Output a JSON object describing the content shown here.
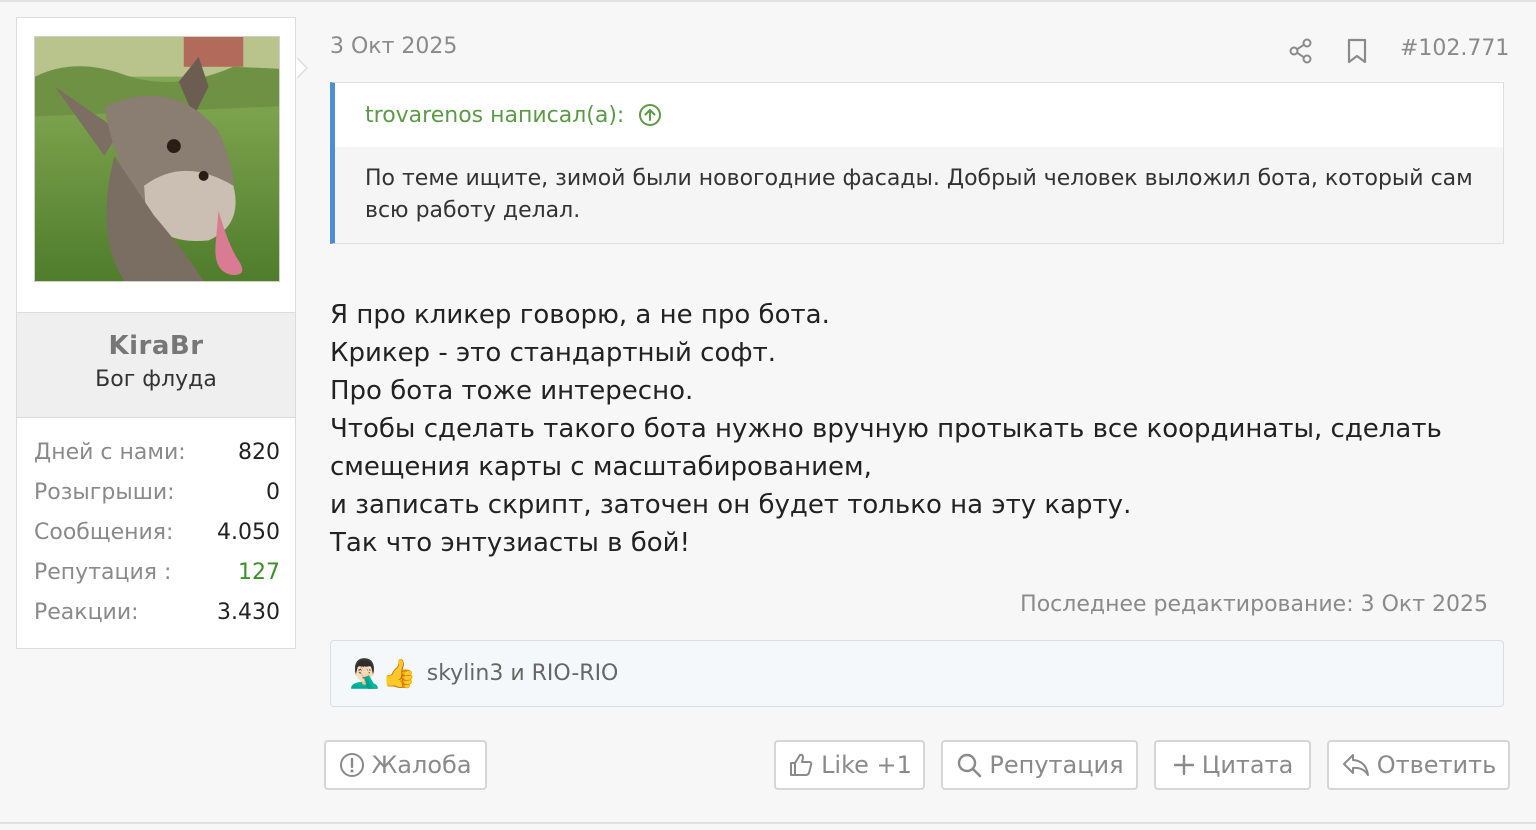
{
  "user": {
    "name": "KiraBr",
    "title": "Бог флуда",
    "stats": [
      {
        "label": "Дней с нами:",
        "value": "820"
      },
      {
        "label": "Розыгрыши:",
        "value": "0"
      },
      {
        "label": "Сообщения:",
        "value": "4.050"
      },
      {
        "label": "Репутация :",
        "value": "127"
      },
      {
        "label": "Реакции:",
        "value": "3.430"
      }
    ]
  },
  "post": {
    "date": "3 Окт 2025",
    "number": "#102.771",
    "quote": {
      "author_line": "trovarenos написал(а):",
      "text": "По теме ищите, зимой были новогодние фасады. Добрый человек выложил бота, который сам всю работу делал."
    },
    "message_lines": [
      "Я про кликер говорю, а не про бота.",
      "Крикер - это стандартный софт.",
      "Про бота тоже интересно.",
      "Чтобы сделать такого бота нужно вручную протыкать все координаты, сделать смещения карты с масштабированием,",
      "и записать скрипт, заточен он будет только на эту карту.",
      "Так что энтузиасты в бой!"
    ],
    "last_edit": "Последнее редактирование: 3 Окт 2025",
    "reactions": {
      "icons": [
        "🤦🏻‍♂️",
        "👍"
      ],
      "users": "skylin3 и RIO-RIO"
    }
  },
  "actions": {
    "report": "Жалоба",
    "like": "Like +1",
    "reputation": "Репутация",
    "quote": "Цитата",
    "reply": "Ответить"
  },
  "colors": {
    "accent_blue": "#4c8ed2",
    "quote_author_green": "#5c9a47",
    "positive_green": "#3e8e2a"
  }
}
